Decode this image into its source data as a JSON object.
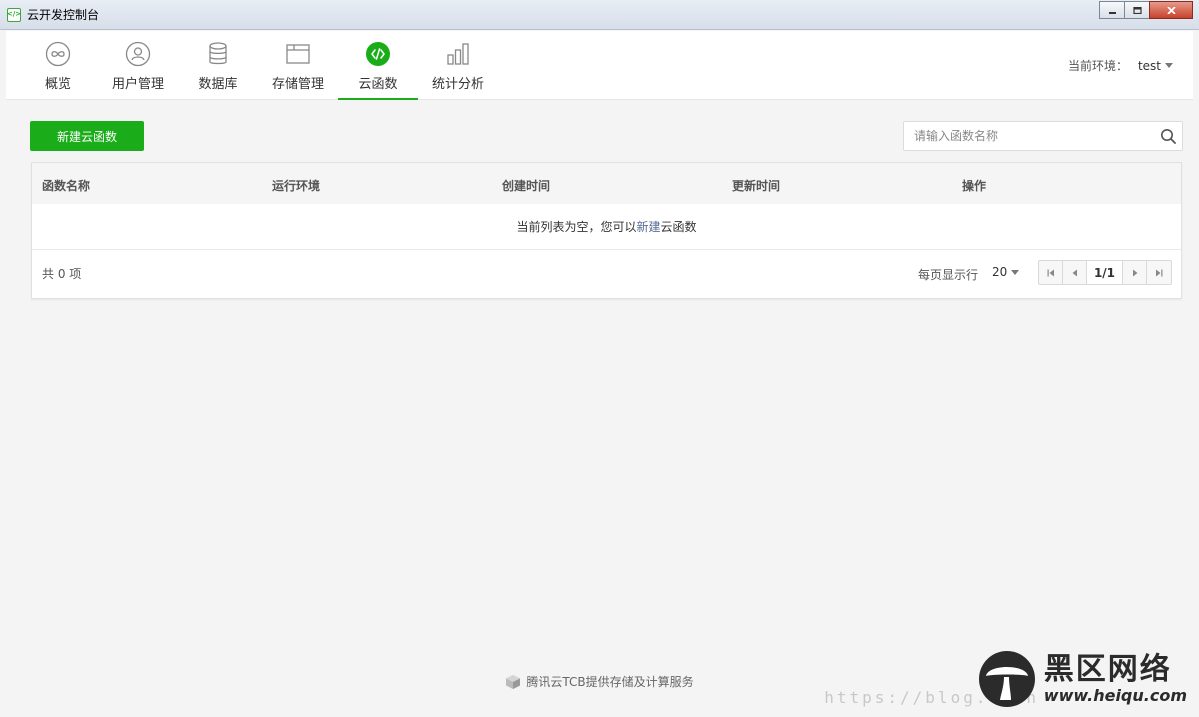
{
  "window": {
    "title": "云开发控制台"
  },
  "nav": {
    "items": [
      {
        "label": "概览",
        "icon": "infinity-icon"
      },
      {
        "label": "用户管理",
        "icon": "user-icon"
      },
      {
        "label": "数据库",
        "icon": "database-icon"
      },
      {
        "label": "存储管理",
        "icon": "folder-icon"
      },
      {
        "label": "云函数",
        "icon": "code-icon",
        "active": true
      },
      {
        "label": "统计分析",
        "icon": "bar-chart-icon"
      }
    ],
    "env_label": "当前环境：",
    "env_value": "test"
  },
  "toolbar": {
    "new_label": "新建云函数",
    "search_placeholder": "请输入函数名称"
  },
  "table": {
    "columns": [
      "函数名称",
      "运行环境",
      "创建时间",
      "更新时间",
      "操作"
    ],
    "empty_prefix": "当前列表为空，您可以",
    "empty_link": "新建",
    "empty_suffix": "云函数"
  },
  "pagination": {
    "total": "共 0 项",
    "per_page_label": "每页显示行",
    "per_page_value": "20",
    "current": "1/1"
  },
  "footer": {
    "text": "腾讯云TCB提供存储及计算服务"
  },
  "watermark": {
    "name": "黑区网络",
    "url": "www.heiqu.com",
    "faint": "https://blog.csdn"
  },
  "colors": {
    "accent": "#1aad19",
    "link": "#576b95"
  }
}
